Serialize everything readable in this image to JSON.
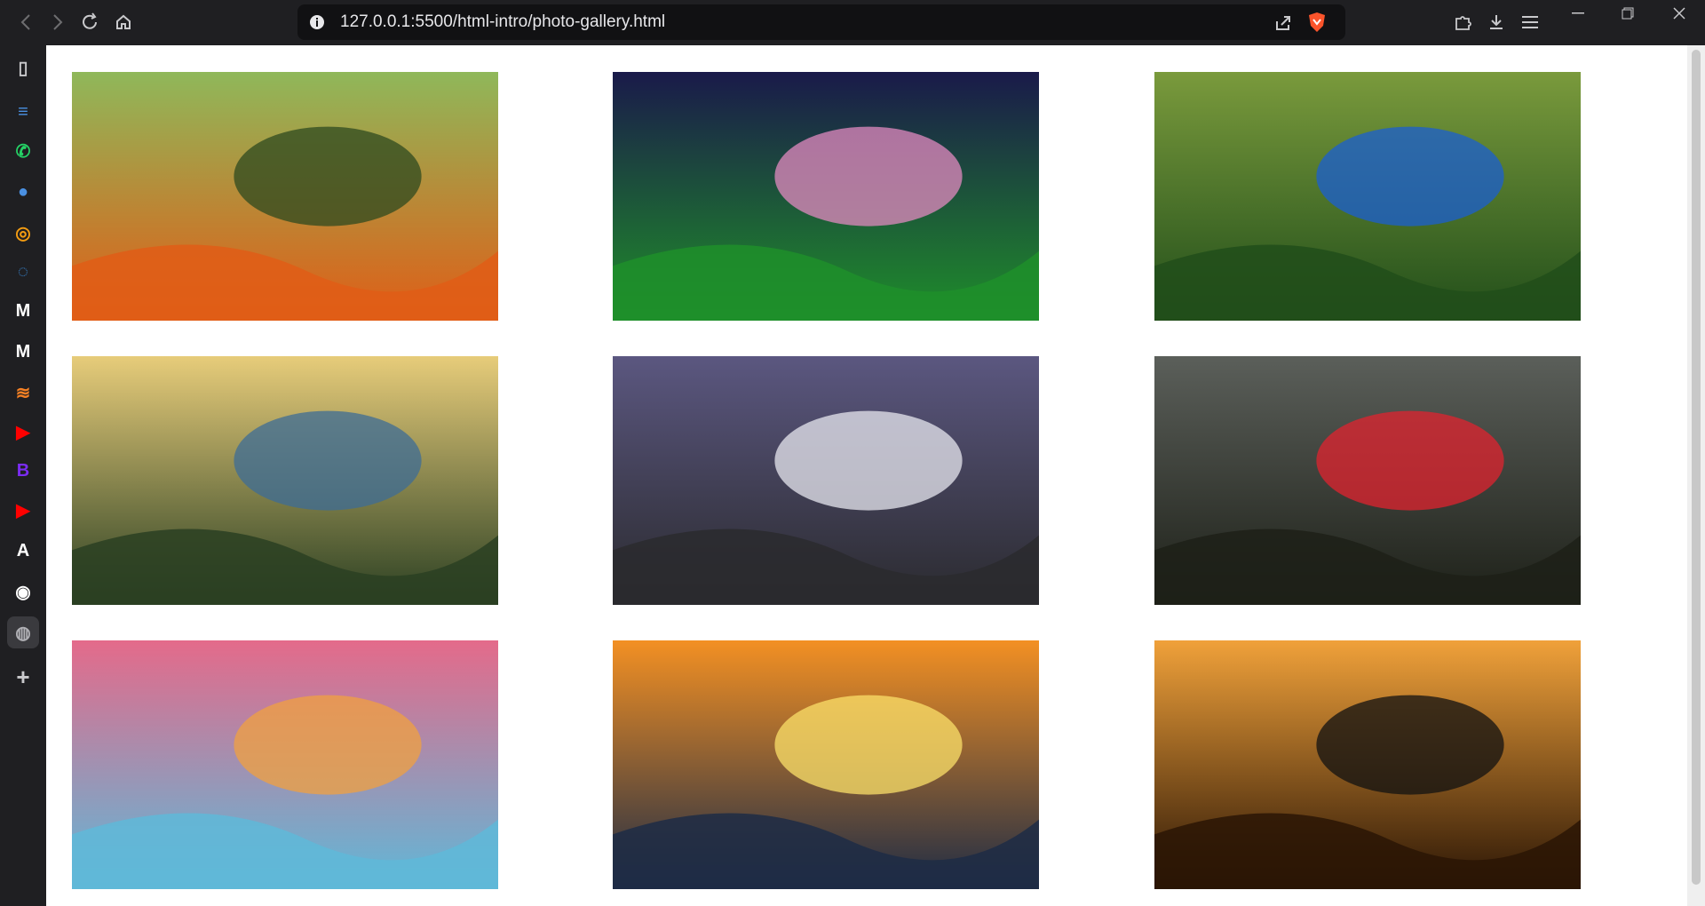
{
  "browser": {
    "url": "127.0.0.1:5500/html-intro/photo-gallery.html",
    "toolbar_icons": [
      "back-icon",
      "forward-icon",
      "reload-icon",
      "home-icon"
    ],
    "right_icons": [
      "share-icon",
      "brave-shield-icon",
      "extensions-icon",
      "download-icon",
      "menu-icon"
    ],
    "window_controls": [
      "minimize-icon",
      "restore-icon",
      "close-icon"
    ]
  },
  "sidebar": {
    "items": [
      {
        "name": "sidebar-panel-icon",
        "glyph": "▯",
        "color": "#c9c9cc"
      },
      {
        "name": "google-docs-icon",
        "glyph": "≡",
        "color": "#4a90e2"
      },
      {
        "name": "whatsapp-icon",
        "glyph": "✆",
        "color": "#25d366"
      },
      {
        "name": "contacts-icon",
        "glyph": "●",
        "color": "#4a90e2"
      },
      {
        "name": "search-app-icon",
        "glyph": "◎",
        "color": "#f39c12"
      },
      {
        "name": "messenger-icon",
        "glyph": "◌",
        "color": "#3a8dde"
      },
      {
        "name": "medium-icon",
        "glyph": "M",
        "color": "#ffffff"
      },
      {
        "name": "medium-icon-2",
        "glyph": "M",
        "color": "#ffffff"
      },
      {
        "name": "stack-overflow-icon",
        "glyph": "≋",
        "color": "#f48024"
      },
      {
        "name": "youtube-icon",
        "glyph": "▶",
        "color": "#ff0000"
      },
      {
        "name": "bootstrap-icon",
        "glyph": "B",
        "color": "#7b2cf3"
      },
      {
        "name": "youtube-icon-2",
        "glyph": "▶",
        "color": "#ff0000"
      },
      {
        "name": "app-a-icon",
        "glyph": "A",
        "color": "#ffffff"
      },
      {
        "name": "github-icon",
        "glyph": "◉",
        "color": "#ffffff"
      },
      {
        "name": "web-icon",
        "glyph": "◍",
        "color": "#b0b0b5"
      },
      {
        "name": "add-panel-icon",
        "glyph": "+",
        "color": "#c9c9cc"
      }
    ]
  },
  "gallery": {
    "photos": [
      {
        "name": "butterfly-photo",
        "sky": "#8fb85a",
        "ground": "#e05d16",
        "accent": "#2d4a1f"
      },
      {
        "name": "moon-fantasy-photo",
        "sky": "#1a1a4a",
        "ground": "#1f8f2a",
        "accent": "#e28ac0"
      },
      {
        "name": "peacock-photo",
        "sky": "#7a9a3c",
        "ground": "#214e1a",
        "accent": "#1b5fd0"
      },
      {
        "name": "lake-forest-photo",
        "sky": "#e7cc7a",
        "ground": "#2a3f22",
        "accent": "#3e6c96"
      },
      {
        "name": "moon-mountain-photo",
        "sky": "#5b5780",
        "ground": "#2a2a2e",
        "accent": "#e7e7ef"
      },
      {
        "name": "hummingbird-photo",
        "sky": "#5b5f5a",
        "ground": "#1d2018",
        "accent": "#e0232f"
      },
      {
        "name": "bubbles-photo",
        "sky": "#e46a8a",
        "ground": "#5fb8d8",
        "accent": "#f0a040"
      },
      {
        "name": "sunset-pier-photo",
        "sky": "#f39023",
        "ground": "#1d2b45",
        "accent": "#fbe06a"
      },
      {
        "name": "couple-sunset-photo",
        "sky": "#f0a13a",
        "ground": "#2a1505",
        "accent": "#111111"
      }
    ]
  }
}
